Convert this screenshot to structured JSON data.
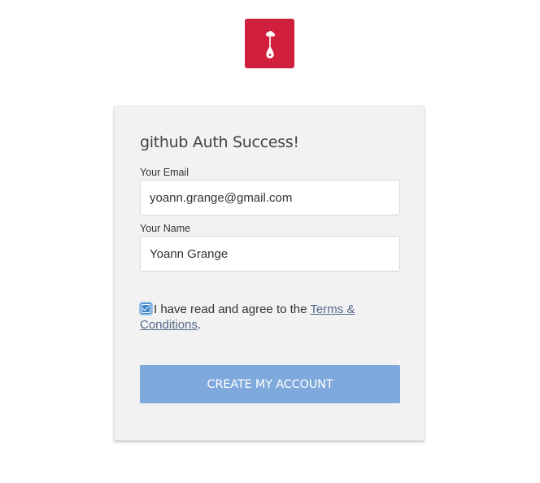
{
  "brand": {
    "logo_icon": "lamp-lightbulb-icon",
    "logo_color": "#cf1f3c"
  },
  "card": {
    "title": "github Auth Success!",
    "email": {
      "label": "Your Email",
      "value": "yoann.grange@gmail.com"
    },
    "name": {
      "label": "Your Name",
      "value": "Yoann Grange"
    },
    "agreement": {
      "checked": true,
      "text_before": "I have read and agree to the ",
      "link_text": "Terms & Conditions",
      "text_after": "."
    },
    "submit_label": "CREATE MY ACCOUNT",
    "submit_color": "#7fa8dc"
  }
}
